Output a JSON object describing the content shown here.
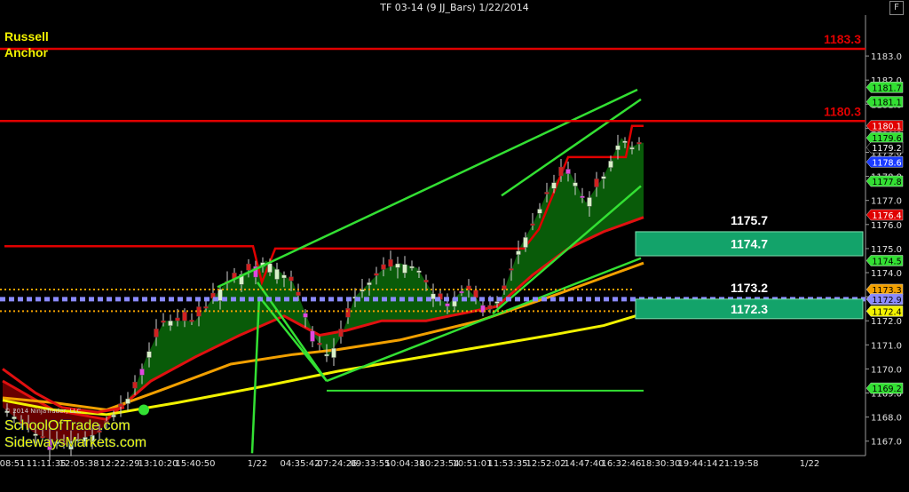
{
  "chart_data": {
    "type": "candlestick",
    "title": "TF 03-14 (9 JJ_Bars)  1/22/2014",
    "labels": {
      "symbol": "Russell",
      "subtitle": "Anchor"
    },
    "ylim": [
      1166.4,
      1184.7
    ],
    "y_ticks": [
      "1183.0",
      "1182.0",
      "1181.0",
      "1180.0",
      "1179.0",
      "1178.0",
      "1177.0",
      "1176.0",
      "1175.0",
      "1174.0",
      "1173.0",
      "1172.0",
      "1171.0",
      "1170.0",
      "1169.0",
      "1168.0",
      "1167.0"
    ],
    "x_tick_labels": [
      "08:51",
      "11:11:35",
      "12:05:38",
      "12:22:29",
      "13:10:20",
      "15:40:50",
      "1/22",
      "04:35:42",
      "07:24:26",
      "09:33:55",
      "10:04:38",
      "10:23:54",
      "10:51:01",
      "11:53:35",
      "12:52:02",
      "14:47:40",
      "16:32:46",
      "18:30:30",
      "19:44:14",
      "21:19:58",
      "1/22"
    ],
    "horizontal_levels": [
      {
        "label": "1183.3",
        "value": 1183.3,
        "color": "#e00000"
      },
      {
        "label": "1180.3",
        "value": 1180.3,
        "color": "#e00000"
      }
    ],
    "zones": [
      {
        "top_label": "1175.7",
        "label": "1174.7",
        "top": 1175.7,
        "bottom": 1174.7,
        "color": "#13a36a"
      },
      {
        "top_label": "1173.2",
        "label": "1172.3",
        "top": 1172.9,
        "bottom": 1172.3,
        "color": "#13a36a"
      }
    ],
    "price_tags": [
      {
        "label": "1181.7",
        "value": 1181.7,
        "color": "#33e033"
      },
      {
        "label": "1181.1",
        "value": 1181.1,
        "color": "#33e033"
      },
      {
        "label": "1180.1",
        "value": 1180.1,
        "color": "#e00000"
      },
      {
        "label": "1179.6",
        "value": 1179.6,
        "color": "#33e033"
      },
      {
        "label": "1179.2",
        "value": 1179.2,
        "color": "#000000"
      },
      {
        "label": "1178.6",
        "value": 1178.6,
        "color": "#1a3cff"
      },
      {
        "label": "1177.8",
        "value": 1177.8,
        "color": "#33e033"
      },
      {
        "label": "1176.4",
        "value": 1176.4,
        "color": "#e00000"
      },
      {
        "label": "1174.5",
        "value": 1174.5,
        "color": "#33e033"
      },
      {
        "label": "1173.3",
        "value": 1173.3,
        "color": "#f2a000"
      },
      {
        "label": "1172.9",
        "value": 1172.9,
        "color": "#8a8aff"
      },
      {
        "label": "1172.4",
        "value": 1172.4,
        "color": "#f2f200"
      },
      {
        "label": "1169.2",
        "value": 1169.2,
        "color": "#33e033"
      }
    ],
    "copyright": "© 2014 NinjaTrader, LLC",
    "watermarks": [
      "SchoolOfTrade.com",
      "SidewaysMarkets.com"
    ]
  }
}
